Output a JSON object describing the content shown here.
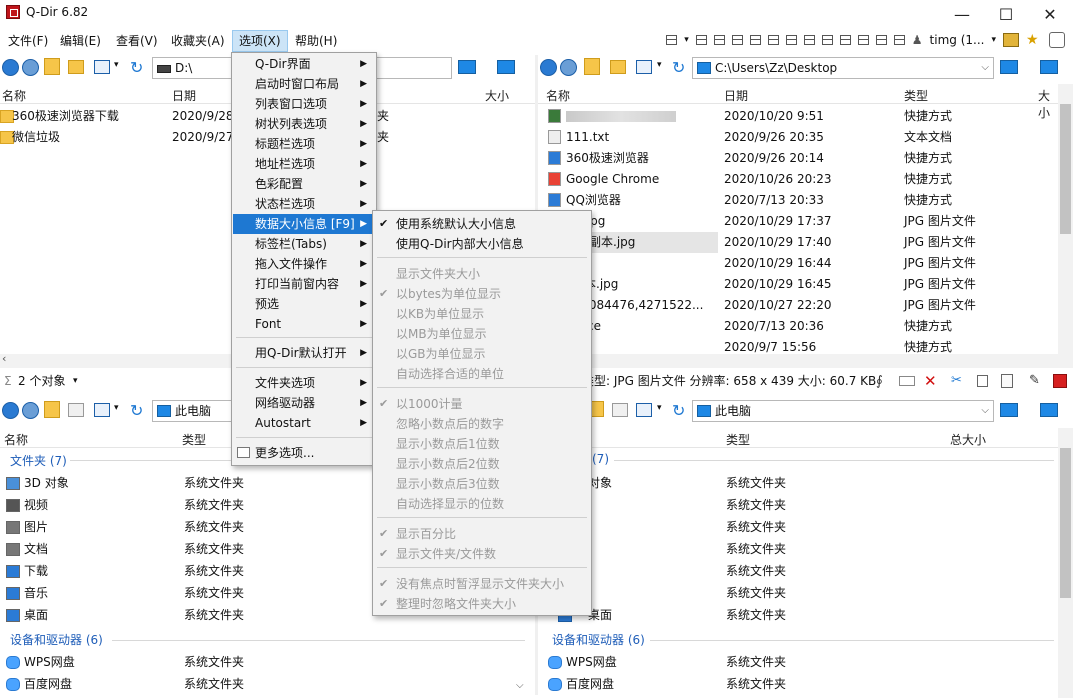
{
  "window": {
    "title": "Q-Dir 6.82",
    "minimize": "—",
    "maximize": "☐",
    "close": "✕"
  },
  "menubar": {
    "items": [
      "文件(F)",
      "编辑(E)",
      "查看(V)",
      "收藏夹(A)",
      "选项(X)",
      "帮助(H)"
    ]
  },
  "topbar": {
    "user": "timg (1...",
    "dropdown": "▾"
  },
  "panes": {
    "top_left": {
      "address": "D:\\",
      "headers": [
        "名称",
        "日期",
        "大小"
      ],
      "rows": [
        {
          "name": "360极速浏览器下载",
          "date": "2020/9/28",
          "type": "夹"
        },
        {
          "name": "微信垃圾",
          "date": "2020/9/27",
          "type": "夹"
        }
      ],
      "status": "2 个对象",
      "status_prefix": "Σ"
    },
    "top_right": {
      "address": "C:\\Users\\Zz\\Desktop",
      "headers": [
        "名称",
        "日期",
        "类型",
        "大小"
      ],
      "rows": [
        {
          "name": "",
          "date": "2020/10/20 9:51",
          "type": "快捷方式"
        },
        {
          "name": "111.txt",
          "date": "2020/9/26 20:35",
          "type": "文本文档"
        },
        {
          "name": "360极速浏览器",
          "date": "2020/9/26 20:14",
          "type": "快捷方式"
        },
        {
          "name": "Google Chrome",
          "date": "2020/10/26 20:23",
          "type": "快捷方式"
        },
        {
          "name": "QQ浏览器",
          "date": "2020/7/13 20:33",
          "type": "快捷方式"
        },
        {
          "name": "(1).jpg",
          "date": "2020/10/29 17:37",
          "type": "JPG 图片文件"
        },
        {
          "name": "(1)_副本.jpg",
          "date": "2020/10/29 17:40",
          "type": "JPG 图片文件"
        },
        {
          "name": "jpg",
          "date": "2020/10/29 16:44",
          "type": "JPG 图片文件"
        },
        {
          "name": "_副本.jpg",
          "date": "2020/10/29 16:45",
          "type": "JPG 图片文件"
        },
        {
          "name": "779084476,4271522...",
          "date": "2020/10/27 22:20",
          "type": "JPG 图片文件"
        },
        {
          "name": "Office",
          "date": "2020/7/13 20:36",
          "type": "快捷方式"
        },
        {
          "name": "网盘",
          "date": "2020/9/7 15:56",
          "type": "快捷方式"
        }
      ],
      "status": "类型: JPG 图片文件 分辨率: 658 x 439 大小: 60.7 KB"
    },
    "bottom_left": {
      "address": "此电脑",
      "headers": [
        "名称",
        "类型"
      ],
      "group1": "文件夹 (7)",
      "rows": [
        {
          "name": "3D 对象",
          "type": "系统文件夹"
        },
        {
          "name": "视频",
          "type": "系统文件夹"
        },
        {
          "name": "图片",
          "type": "系统文件夹"
        },
        {
          "name": "文档",
          "type": "系统文件夹"
        },
        {
          "name": "下载",
          "type": "系统文件夹"
        },
        {
          "name": "音乐",
          "type": "系统文件夹"
        },
        {
          "name": "桌面",
          "type": "系统文件夹"
        }
      ],
      "group2": "设备和驱动器 (6)",
      "drives": [
        {
          "name": "WPS网盘",
          "type": "系统文件夹"
        },
        {
          "name": "百度网盘",
          "type": "系统文件夹"
        }
      ]
    },
    "bottom_right": {
      "address": "此电脑",
      "headers": [
        "名称",
        "类型",
        "总大小"
      ],
      "group1": "(7)",
      "rows": [
        {
          "name": "对象",
          "type": "系统文件夹"
        },
        {
          "name": "",
          "type": "系统文件夹"
        },
        {
          "name": "",
          "type": "系统文件夹"
        },
        {
          "name": "",
          "type": "系统文件夹"
        },
        {
          "name": "",
          "type": "系统文件夹"
        },
        {
          "name": "",
          "type": "系统文件夹"
        },
        {
          "name": "桌面",
          "type": "系统文件夹"
        }
      ],
      "group2": "设备和驱动器 (6)",
      "drives": [
        {
          "name": "WPS网盘",
          "type": "系统文件夹"
        },
        {
          "name": "百度网盘",
          "type": "系统文件夹"
        }
      ]
    }
  },
  "options_menu": {
    "items": [
      "Q-Dir界面",
      "启动时窗口布局",
      "列表窗口选项",
      "树状列表选项",
      "标题栏选项",
      "地址栏选项",
      "色彩配置",
      "状态栏选项",
      "数据大小信息  [F9]",
      "标签栏(Tabs)",
      "拖入文件操作",
      "打印当前窗内容",
      "预选",
      "Font",
      "用Q-Dir默认打开",
      "文件夹选项",
      "网络驱动器",
      "Autostart",
      "更多选项..."
    ]
  },
  "size_submenu": {
    "items": [
      "使用系统默认大小信息",
      "使用Q-Dir内部大小信息",
      "显示文件夹大小",
      "以bytes为单位显示",
      "以KB为单位显示",
      "以MB为单位显示",
      "以GB为单位显示",
      "自动选择合适的单位",
      "以1000计量",
      "忽略小数点后的数字",
      "显示小数点后1位数",
      "显示小数点后2位数",
      "显示小数点后3位数",
      "自动选择显示的位数",
      "显示百分比",
      "显示文件夹/文件数",
      "没有焦点时暂浮显示文件夹大小",
      "整理时忽略文件夹大小"
    ]
  },
  "colors": {
    "accent": "#1e78d2",
    "highlight_menu": "#cce4f7",
    "folder": "#f6c549",
    "group_text": "#1e5db8"
  }
}
